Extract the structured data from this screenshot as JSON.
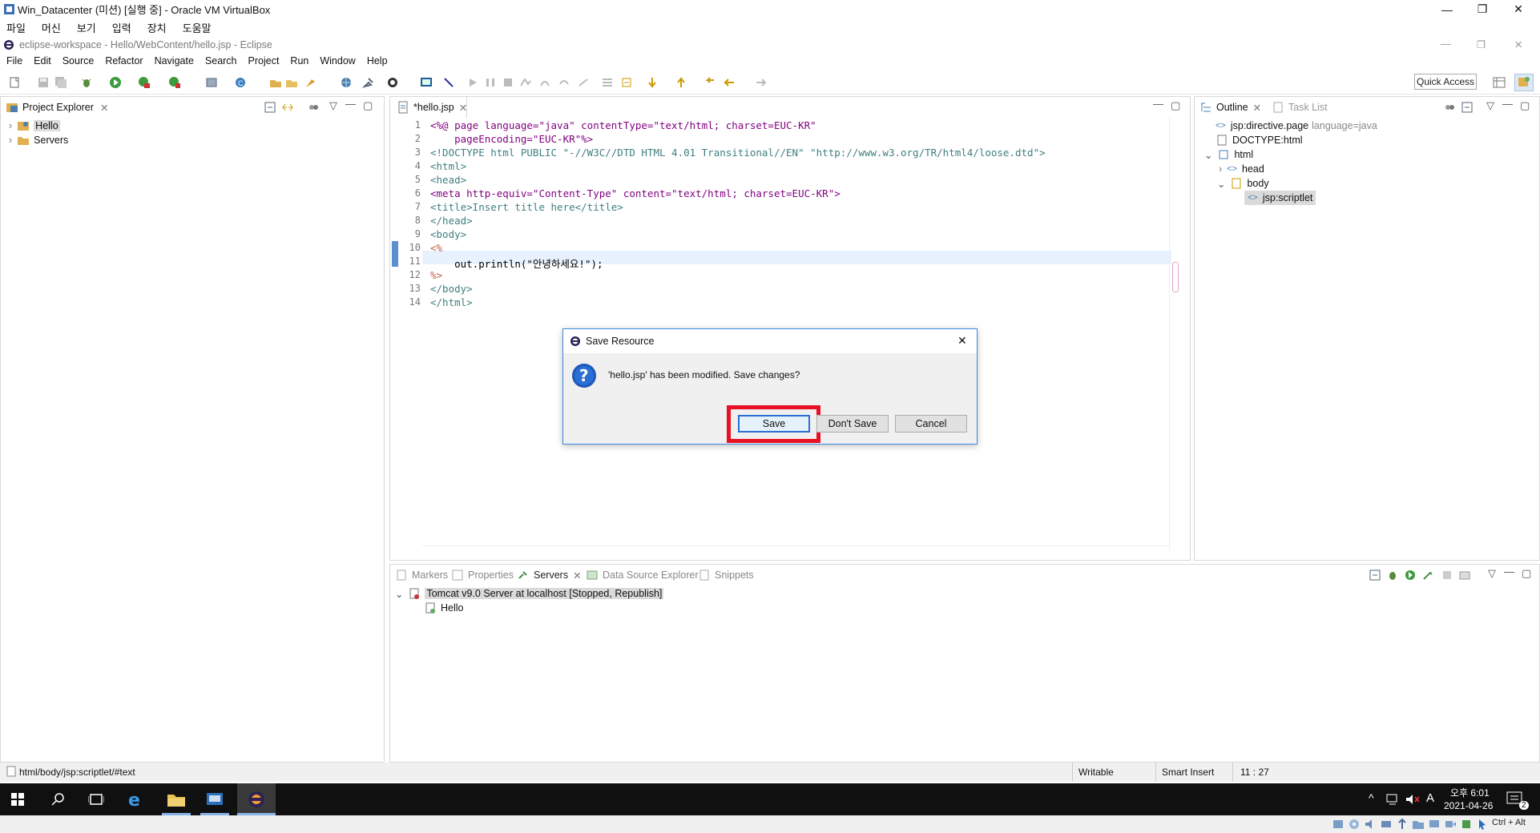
{
  "vbox": {
    "title": "Win_Datacenter (미션) [실행 중] - Oracle VM VirtualBox",
    "menu": [
      "파일",
      "머신",
      "보기",
      "입력",
      "장치",
      "도움말"
    ]
  },
  "eclipse": {
    "title": "eclipse-workspace - Hello/WebContent/hello.jsp - Eclipse",
    "menu": [
      "File",
      "Edit",
      "Source",
      "Refactor",
      "Navigate",
      "Search",
      "Project",
      "Run",
      "Window",
      "Help"
    ],
    "quick_access": "Quick Access"
  },
  "project_explorer": {
    "tab": "Project Explorer",
    "items": [
      "Hello",
      "Servers"
    ]
  },
  "editor": {
    "tab": "*hello.jsp",
    "line_numbers": [
      "1",
      "2",
      "3",
      "4",
      "5",
      "6",
      "7",
      "8",
      "9",
      "10",
      "11",
      "12",
      "13",
      "14"
    ],
    "lines": [
      "<%@ page language=\"java\" contentType=\"text/html; charset=EUC-KR\"",
      "    pageEncoding=\"EUC-KR\"%>",
      "<!DOCTYPE html PUBLIC \"-//W3C//DTD HTML 4.01 Transitional//EN\" \"http://www.w3.org/TR/html4/loose.dtd\">",
      "<html>",
      "<head>",
      "<meta http-equiv=\"Content-Type\" content=\"text/html; charset=EUC-KR\">",
      "<title>Insert title here</title>",
      "</head>",
      "<body>",
      "<%",
      "    out.println(\"안녕하세요!\");",
      "%>",
      "</body>",
      "</html>"
    ]
  },
  "outline": {
    "tab": "Outline",
    "tab2": "Task List",
    "items": [
      "jsp:directive.page",
      "language=java",
      "DOCTYPE:html",
      "html",
      "head",
      "body",
      "jsp:scriptlet"
    ]
  },
  "bottom_panel": {
    "tabs": [
      "Markers",
      "Properties",
      "Servers",
      "Data Source Explorer",
      "Snippets"
    ],
    "server": "Tomcat v9.0 Server at localhost  [Stopped, Republish]",
    "child": "Hello"
  },
  "dialog": {
    "title": "Save Resource",
    "message": "'hello.jsp' has been modified. Save changes?",
    "save": "Save",
    "dont_save": "Don't Save",
    "cancel": "Cancel"
  },
  "status": {
    "path": "html/body/jsp:scriptlet/#text",
    "writable": "Writable",
    "insert": "Smart Insert",
    "position": "11 : 27"
  },
  "taskbar": {
    "time": "오후 6:01",
    "date": "2021-04-26",
    "ime": "A",
    "notif": "2",
    "host_key": "Ctrl + Alt"
  },
  "colors": {
    "accent": "#3c8be0",
    "highlight": "#e81123",
    "code_tag": "#3f7f7f",
    "code_attr": "#7f007f",
    "code_string": "#2a00ff",
    "jsp_delim": "#bf5f3f"
  }
}
